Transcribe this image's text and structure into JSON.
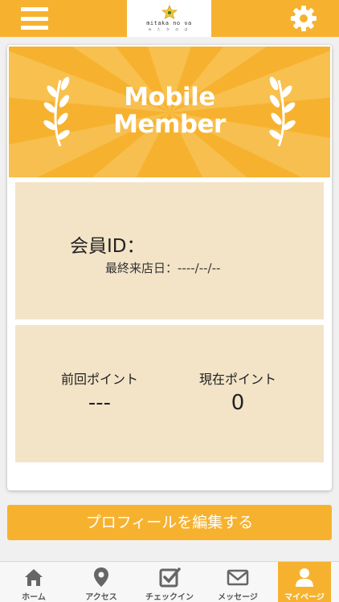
{
  "header": {
    "logo_text": "mitaka no va",
    "logo_subtext": "み た か の ば"
  },
  "banner": {
    "title_line1": "Mobile",
    "title_line2": "Member"
  },
  "member": {
    "id_label": "会員ID：",
    "last_visit": "最終来店日：----/--/--"
  },
  "points": {
    "previous_label": "前回ポイント",
    "previous_value": "---",
    "current_label": "現在ポイント",
    "current_value": "0"
  },
  "edit_profile_label": "プロフィールを編集する",
  "tabs": [
    {
      "label": "ホーム",
      "icon": "home-icon"
    },
    {
      "label": "アクセス",
      "icon": "map-pin-icon"
    },
    {
      "label": "チェックイン",
      "icon": "checkin-icon"
    },
    {
      "label": "メッセージ",
      "icon": "mail-icon"
    },
    {
      "label": "マイページ",
      "icon": "user-icon"
    }
  ],
  "colors": {
    "accent": "#f6b22f",
    "panel": "#f3e4c8"
  }
}
